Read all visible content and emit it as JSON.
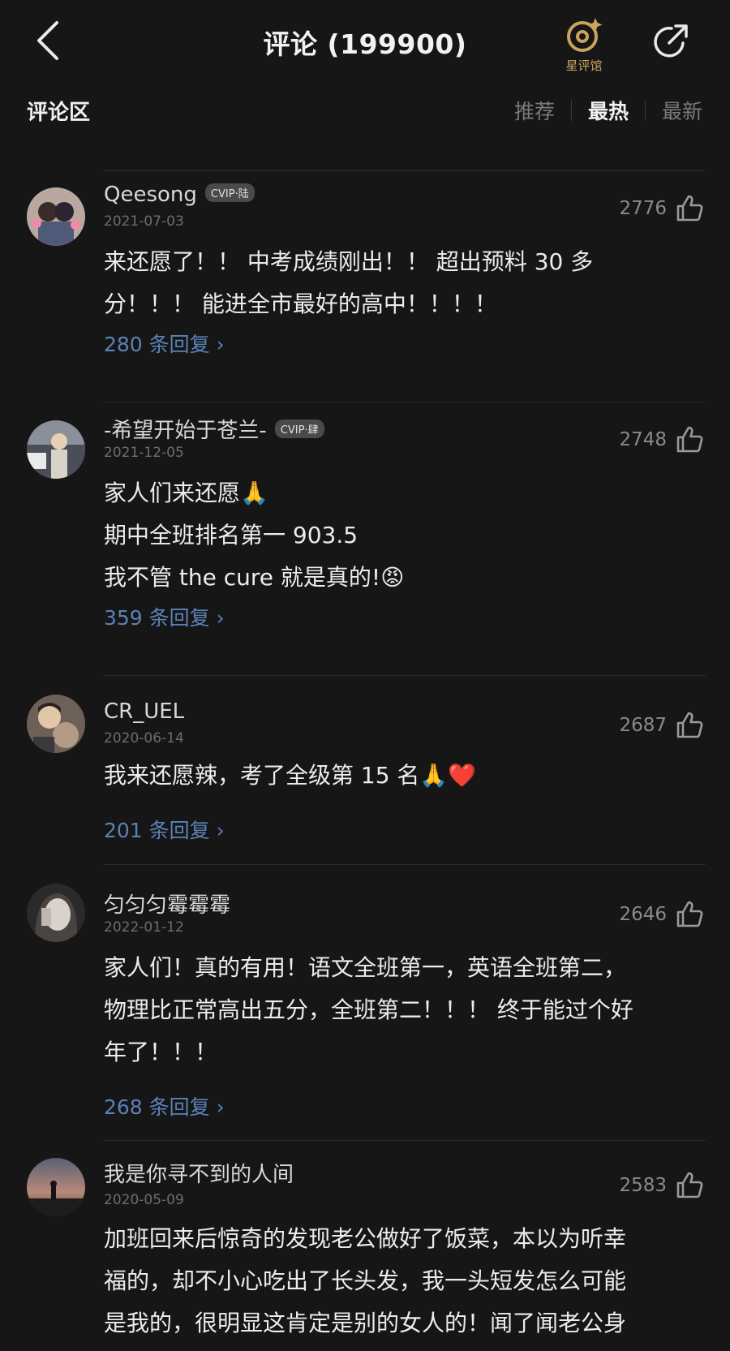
{
  "header": {
    "title": "评论 (199900)",
    "star_hall_label": "星评馆"
  },
  "section": {
    "title": "评论区",
    "tabs": [
      {
        "label": "推荐",
        "active": false
      },
      {
        "label": "最热",
        "active": true
      },
      {
        "label": "最新",
        "active": false
      }
    ]
  },
  "colors": {
    "background": "#161616",
    "reply_link": "#5b82b7",
    "star_gold": "#c9a35c"
  },
  "comments": [
    {
      "username": "Qeesong",
      "badge": "CVIP·陆",
      "date": "2021-07-03",
      "likes": "2776",
      "lines": [
        "来还愿了！！ 中考成绩刚出！！ 超出预料 30 多",
        "分！！！ 能进全市最好的高中！！！！"
      ],
      "replies": "280 条回复 ›"
    },
    {
      "username": "-希望开始于苍兰-",
      "badge": "CVIP·肆",
      "date": "2021-12-05",
      "likes": "2748",
      "lines": [
        "家人们来还愿🙏",
        "期中全班排名第一  903.5",
        "我不管 the cure 就是真的!😡"
      ],
      "replies": "359 条回复 ›"
    },
    {
      "username": "CR_UEL",
      "badge": "",
      "date": "2020-06-14",
      "likes": "2687",
      "lines": [
        "我来还愿辣，考了全级第 15 名🙏❤️"
      ],
      "replies": "201 条回复 ›"
    },
    {
      "username": "匀匀匀霉霉霉",
      "badge": "",
      "date": "2022-01-12",
      "likes": "2646",
      "lines": [
        "家人们！真的有用！语文全班第一，英语全班第二，",
        "物理比正常高出五分，全班第二！！！ 终于能过个好",
        "年了！！！"
      ],
      "replies": "268 条回复 ›"
    },
    {
      "username": "我是你寻不到的人间",
      "badge": "",
      "date": "2020-05-09",
      "likes": "2583",
      "lines": [
        "加班回来后惊奇的发现老公做好了饭菜，本以为听幸",
        "福的，却不小心吃出了长头发，我一头短发怎么可能",
        "是我的，很明显这肯定是别的女人的！闻了闻老公身"
      ],
      "replies": ""
    }
  ]
}
